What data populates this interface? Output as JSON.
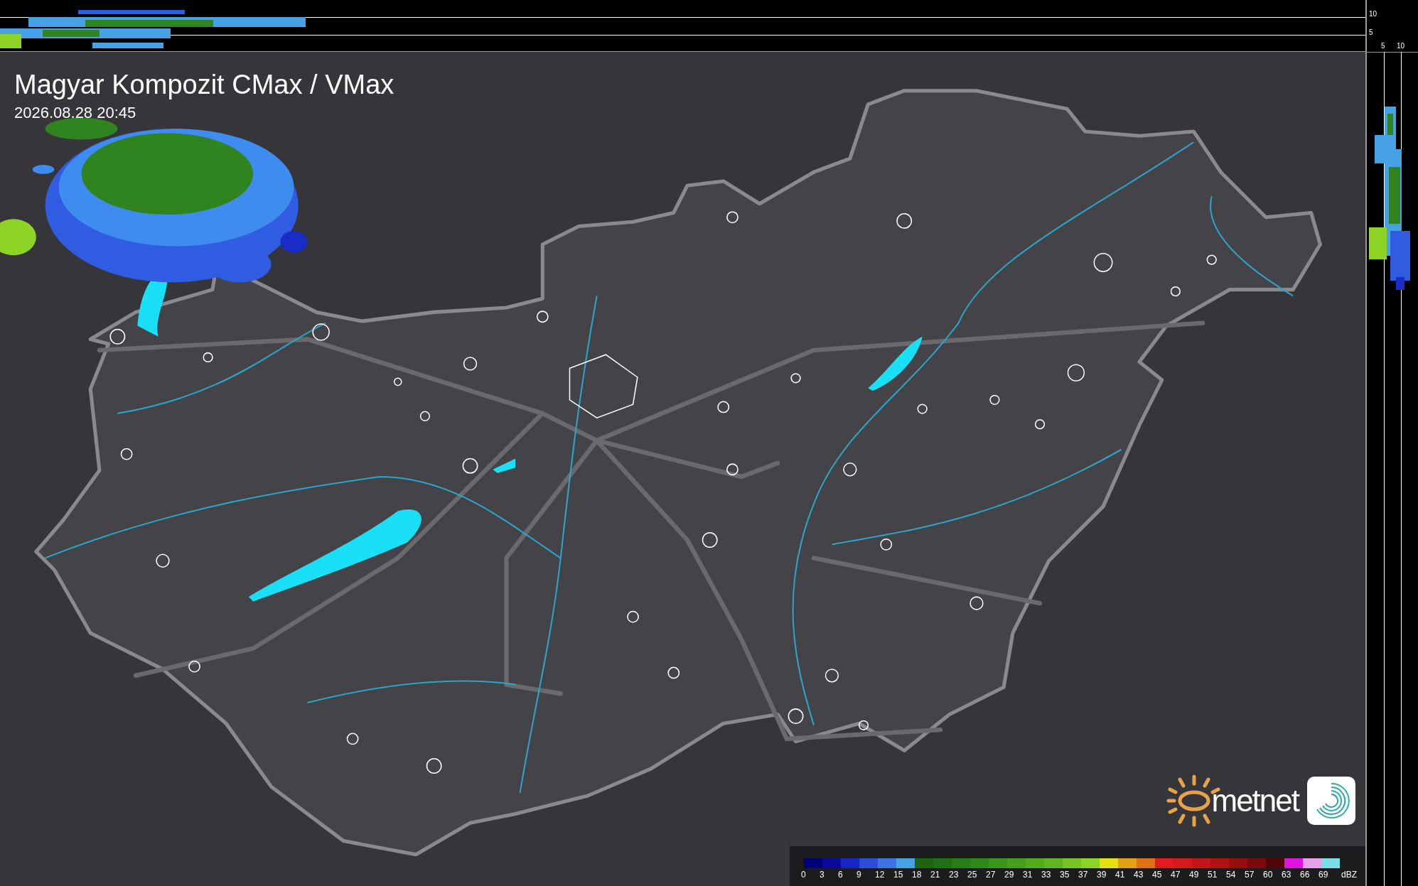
{
  "title": "Magyar Kompozit CMax / VMax",
  "timestamp": "2026.08.28 20:45",
  "top_profile_axis": [
    "10",
    "5"
  ],
  "side_profile_axis": [
    "5",
    "10"
  ],
  "logo": {
    "text": "metnet"
  },
  "legend": {
    "unit": "dBZ",
    "steps": [
      {
        "label": "0",
        "color": "#00007a"
      },
      {
        "label": "3",
        "color": "#0a0a9c"
      },
      {
        "label": "6",
        "color": "#1426c4"
      },
      {
        "label": "9",
        "color": "#2a4ed8"
      },
      {
        "label": "12",
        "color": "#3a74e0"
      },
      {
        "label": "15",
        "color": "#46a2e4"
      },
      {
        "label": "18",
        "color": "#1c6410"
      },
      {
        "label": "21",
        "color": "#207014"
      },
      {
        "label": "23",
        "color": "#287e16"
      },
      {
        "label": "25",
        "color": "#2e8a18"
      },
      {
        "label": "27",
        "color": "#38961a"
      },
      {
        "label": "29",
        "color": "#44a01c"
      },
      {
        "label": "31",
        "color": "#52ac1e"
      },
      {
        "label": "33",
        "color": "#60b620"
      },
      {
        "label": "35",
        "color": "#74c422"
      },
      {
        "label": "37",
        "color": "#8ed426"
      },
      {
        "label": "39",
        "color": "#e4e014"
      },
      {
        "label": "41",
        "color": "#e4a014"
      },
      {
        "label": "43",
        "color": "#e07018"
      },
      {
        "label": "45",
        "color": "#e21c1c"
      },
      {
        "label": "47",
        "color": "#d41a1a"
      },
      {
        "label": "49",
        "color": "#c41616"
      },
      {
        "label": "51",
        "color": "#b01212"
      },
      {
        "label": "54",
        "color": "#960e0e"
      },
      {
        "label": "57",
        "color": "#7a0a0a"
      },
      {
        "label": "60",
        "color": "#500606"
      },
      {
        "label": "63",
        "color": "#e014e0"
      },
      {
        "label": "66",
        "color": "#e6a0e6"
      },
      {
        "label": "69",
        "color": "#7adce4"
      }
    ]
  }
}
